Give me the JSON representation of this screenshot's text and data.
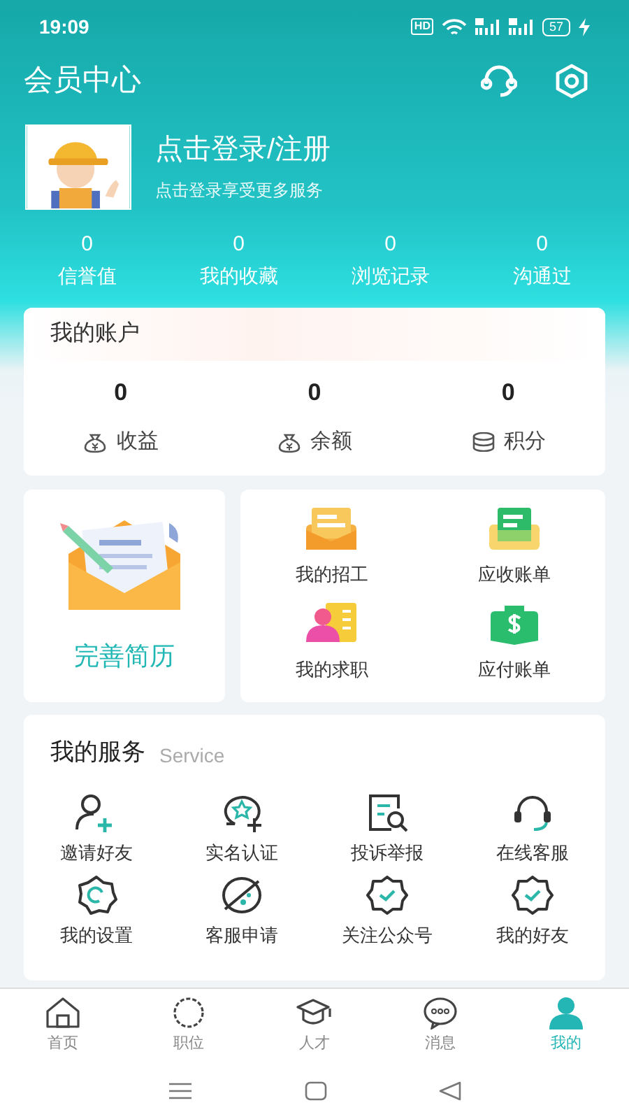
{
  "status_bar": {
    "time": "19:09",
    "hd": "HD",
    "battery": "57"
  },
  "header": {
    "title": "会员中心"
  },
  "profile": {
    "name": "点击登录/注册",
    "subtitle": "点击登录享受更多服务"
  },
  "stats": [
    {
      "value": "0",
      "label": "信誉值"
    },
    {
      "value": "0",
      "label": "我的收藏"
    },
    {
      "value": "0",
      "label": "浏览记录"
    },
    {
      "value": "0",
      "label": "沟通过"
    }
  ],
  "account": {
    "title": "我的账户",
    "items": [
      {
        "value": "0",
        "label": "收益"
      },
      {
        "value": "0",
        "label": "余额"
      },
      {
        "value": "0",
        "label": "积分"
      }
    ]
  },
  "resume": {
    "label": "完善简历"
  },
  "shortcuts": [
    {
      "label": "我的招工"
    },
    {
      "label": "应收账单"
    },
    {
      "label": "我的求职"
    },
    {
      "label": "应付账单"
    }
  ],
  "services": {
    "title": "我的服务",
    "subtitle": "Service",
    "items": [
      {
        "label": "邀请好友"
      },
      {
        "label": "实名认证"
      },
      {
        "label": "投诉举报"
      },
      {
        "label": "在线客服"
      },
      {
        "label": "我的设置"
      },
      {
        "label": "客服申请"
      },
      {
        "label": "关注公众号"
      },
      {
        "label": "我的好友"
      }
    ]
  },
  "tab_bar": [
    {
      "label": "首页",
      "selected": false
    },
    {
      "label": "职位",
      "selected": false
    },
    {
      "label": "人才",
      "selected": false
    },
    {
      "label": "消息",
      "selected": false
    },
    {
      "label": "我的",
      "selected": true
    }
  ]
}
